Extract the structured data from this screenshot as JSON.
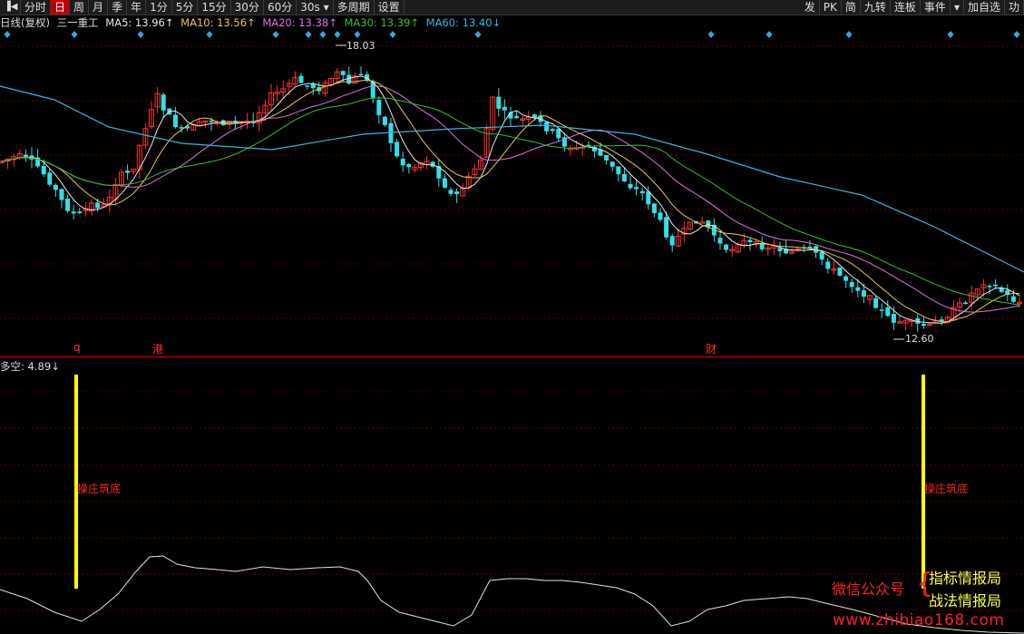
{
  "toolbar": {
    "left_items": [
      "分时",
      "日",
      "周",
      "月",
      "季",
      "年",
      "1分",
      "5分",
      "15分",
      "30分",
      "60分",
      "30s",
      "多周期",
      "设置"
    ],
    "active": "日",
    "right_items": [
      "发",
      "PK",
      "简",
      "九转",
      "连板",
      "事件",
      "加自选",
      "功"
    ]
  },
  "ma_line": {
    "period": "日线(复权)",
    "stock": "三一重工",
    "ma5": {
      "label": "MA5: 13.96↑",
      "color": "#e8e8e8"
    },
    "ma10": {
      "label": "MA10: 13.56↑",
      "color": "#e8c840"
    },
    "ma20": {
      "label": "MA20: 13.38↑",
      "color": "#e070e0"
    },
    "ma30": {
      "label": "MA30: 13.39↑",
      "color": "#30c030"
    },
    "ma60": {
      "label": "MA60: 13.40↓",
      "color": "#30b8e0"
    }
  },
  "price_marks": {
    "high": "18.03",
    "low": "12.60"
  },
  "markers": {
    "m1": "q",
    "m2": "港",
    "m3": "财"
  },
  "indicator": {
    "title": "多空: 4.89↓"
  },
  "signals": {
    "text": "操庄筑底"
  },
  "watermark": {
    "line1": "微信公众号",
    "line2": "指标情报局",
    "line3": "战法情报局",
    "line4": "www.zhibiao168.com"
  },
  "colors": {
    "up": "#ff3030",
    "down": "#30e0e8",
    "signal": "#ffff00",
    "grid": "#6a0000"
  }
}
